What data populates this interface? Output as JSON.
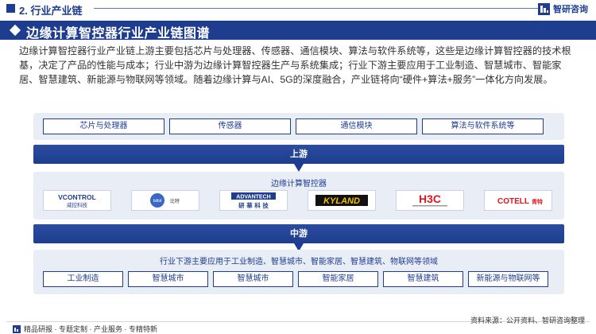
{
  "header": {
    "section": "2. 行业产业链",
    "brand": "智研咨询"
  },
  "title": "边缘计算智控器行业产业链图谱",
  "intro": "边缘计算智控器行业产业链上游主要包括芯片与处理器、传感器、通信模块、算法与软件系统等，这些是边缘计算智控器的技术根基，决定了产品的性能与成本；行业中游为边缘计算智控器生产与系统集成；行业下游主要应用于工业制造、智慧城市、智能家居、智慧建筑、新能源与物联网等领域。随着边缘计算与AI、5G的深度融合，产业链将向“硬件+算法+服务”一体化方向发展。",
  "upstream": {
    "items": [
      "芯片与处理器",
      "传感器",
      "通信模块",
      "算法与软件系统等"
    ],
    "band_label": "上游"
  },
  "midstream": {
    "title": "边缘计算智控器",
    "logos": [
      {
        "main": "VCONTROL",
        "sub": "威控科技"
      },
      {
        "main": "bitbit",
        "sub": "比特"
      },
      {
        "main": "ADVANTECH",
        "sub": "研 華 科 技"
      },
      {
        "main": "KYLAND",
        "sub": ""
      },
      {
        "main": "H3C",
        "sub": ""
      },
      {
        "main": "COTELL",
        "sub": "青特"
      }
    ],
    "band_label": "中游"
  },
  "downstream": {
    "title": "行业下游主要应用于工业制造、智慧城市、智能家居、智慧建筑、物联网等领域",
    "items": [
      "工业制造",
      "智慧城市",
      "智慧城市",
      "智能家居",
      "智慧建筑",
      "新能源与物联网等"
    ]
  },
  "footer": {
    "left": "精品研报 · 专题定制 · 产业服务 · 专精特新",
    "source": "资料来源：公开资料、智研咨询整理"
  },
  "colors": {
    "brand_blue": "#1e3d8f",
    "panel_bg": "#e8edf6"
  }
}
